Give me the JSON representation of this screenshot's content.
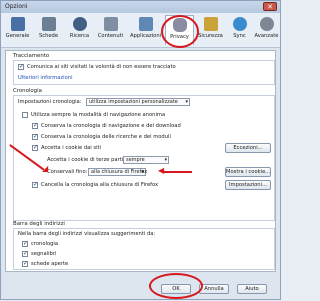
{
  "window": {
    "title": "Opzioni",
    "close_glyph": "✕"
  },
  "tabs": [
    {
      "label": "Generale",
      "icon": "toggle-switch-icon",
      "color": "#4a6fa5"
    },
    {
      "label": "Schede",
      "icon": "tabs-icon",
      "color": "#6d7f95"
    },
    {
      "label": "Ricerca",
      "icon": "search-icon",
      "color": "#3f5f86"
    },
    {
      "label": "Contenuti",
      "icon": "document-icon",
      "color": "#7f8fa3"
    },
    {
      "label": "Applicazioni",
      "icon": "applications-icon",
      "color": "#5e88b5"
    },
    {
      "label": "Privacy",
      "icon": "privacy-mask-icon",
      "color": "#8b8ba1",
      "active": true
    },
    {
      "label": "Sicurezza",
      "icon": "lock-icon",
      "color": "#c9a23a"
    },
    {
      "label": "Sync",
      "icon": "sync-icon",
      "color": "#3c8bd0"
    },
    {
      "label": "Avanzate",
      "icon": "gear-icon",
      "color": "#7d8894"
    }
  ],
  "tracking": {
    "title": "Tracciamento",
    "dnt_label": "Comunica ai siti visitati la volontà di non essere tracciato",
    "dnt_checked": true,
    "more_info": "Ulteriori informazioni"
  },
  "history": {
    "title": "Cronologia",
    "settings_label": "Impostazioni cronologia:",
    "settings_value": "utilizza impostazioni personalizzate",
    "private_mode": "Utilizza sempre la modalità di navigazione anonima",
    "keep_nav": "Conserva la cronologia di navigazione e dei download",
    "keep_search": "Conserva la cronologia delle ricerche e dei moduli",
    "accept_cookies": "Accetta i cookie dai siti",
    "exceptions_btn": "Eccezioni...",
    "third_party_label": "Accetta i cookie di terze parti:",
    "third_party_value": "sempre",
    "keep_until_label": "Conservali fino:",
    "keep_until_value": "alla chiusura di Firefox",
    "show_cookies_btn": "Mostra i cookie...",
    "clear_on_close": "Cancella la cronologia alla chiusura di Firefox",
    "settings_btn": "Impostazioni..."
  },
  "addressbar": {
    "title": "Barra degli indirizzi",
    "description": "Nella barra degli indirizzi visualizza suggerimenti da:",
    "items": [
      {
        "label": "cronologia",
        "checked": true
      },
      {
        "label": "segnalibri",
        "checked": true
      },
      {
        "label": "schede aperte",
        "checked": true
      }
    ]
  },
  "footer": {
    "ok": "OK",
    "cancel": "Annulla",
    "help": "Aiuto"
  },
  "accent_color": "#d6181f"
}
